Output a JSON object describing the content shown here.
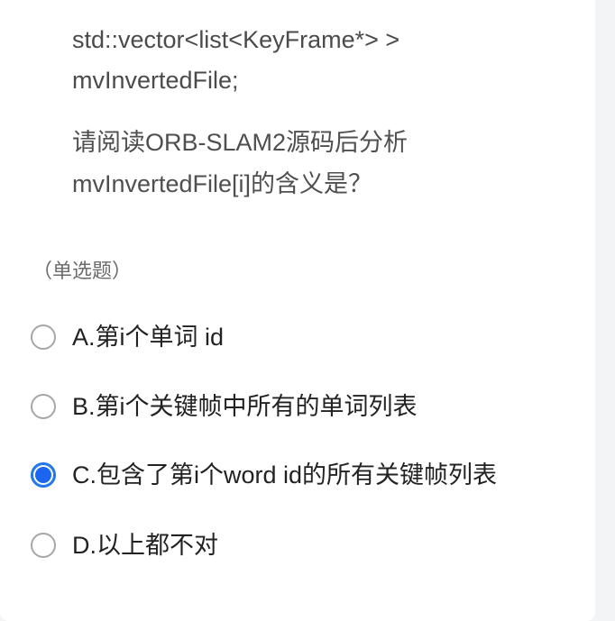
{
  "question": {
    "code_line_1": "std::vector<list<KeyFrame*> >",
    "code_line_2": "mvInvertedFile;",
    "prompt_line_1": "请阅读ORB-SLAM2源码后分析",
    "prompt_line_2": "mvInvertedFile[i]的含义是？"
  },
  "question_type": "（单选题）",
  "options": [
    {
      "label": "A.第i个单词 id",
      "selected": false
    },
    {
      "label": "B.第i个关键帧中所有的单词列表",
      "selected": false
    },
    {
      "label": "C.包含了第i个word id的所有关键帧列表",
      "selected": true
    },
    {
      "label": "D.以上都不对",
      "selected": false
    }
  ],
  "colors": {
    "accent": "#1a66f0",
    "radio_border": "#a7a7a7",
    "page_background": "#f3f4f6",
    "card_background": "#ffffff"
  }
}
